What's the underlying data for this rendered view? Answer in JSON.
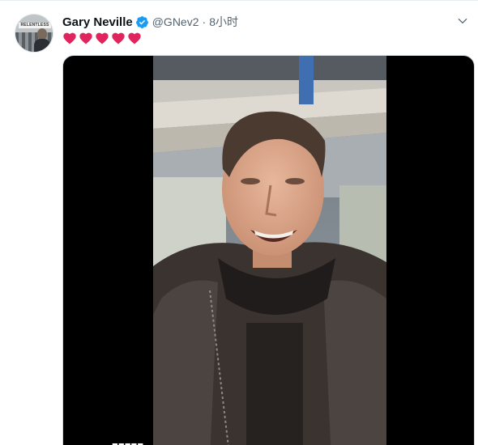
{
  "author": {
    "name": "Gary Neville",
    "handle": "@GNev2",
    "separator": "·",
    "time": "8小时",
    "verified": true,
    "avatar_banner": "RELENTLESS"
  },
  "tweet": {
    "text_icons": [
      "heart-icon",
      "heart-icon",
      "heart-icon",
      "heart-icon",
      "heart-icon"
    ],
    "heart_color": "#e0245e"
  },
  "media": {
    "type": "video",
    "caption_overlay": "■■■■■"
  },
  "colors": {
    "verified": "#1d9bf0",
    "secondary_text": "#536471",
    "border": "#e6ecf0"
  }
}
